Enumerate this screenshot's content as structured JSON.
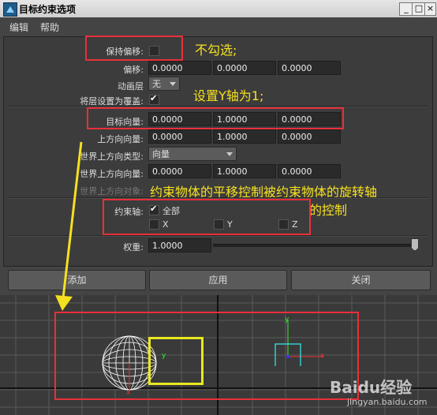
{
  "window": {
    "title": "目标约束选项"
  },
  "menu": {
    "items": [
      "编辑",
      "帮助"
    ]
  },
  "options": {
    "maintain_offset_label": "保持偏移:",
    "maintain_offset_checked": false,
    "offset_label": "偏移:",
    "offset_values": [
      "0.0000",
      "0.0000",
      "0.0000"
    ],
    "anim_layer_label": "动画层",
    "anim_layer_value": "无",
    "set_layer_override_label": "将层设置为覆盖:",
    "set_layer_override_checked": true,
    "aim_vector_label": "目标向量:",
    "aim_vector_values": [
      "0.0000",
      "1.0000",
      "0.0000"
    ],
    "up_vector_label": "上方向向量:",
    "up_vector_values": [
      "0.0000",
      "1.0000",
      "0.0000"
    ],
    "world_up_type_label": "世界上方向类型:",
    "world_up_type_value": "向量",
    "world_up_vector_label": "世界上方向向量:",
    "world_up_vector_values": [
      "0.0000",
      "1.0000",
      "0.0000"
    ],
    "world_up_object_label": "世界上方向对象:",
    "constraint_axes_label": "约束轴:",
    "axis_all_label": "全部",
    "axis_all_checked": true,
    "axis_x_label": "X",
    "axis_y_label": "Y",
    "axis_z_label": "Z",
    "weight_label": "权重:",
    "weight_value": "1.0000",
    "weight_slider_fraction": 1.0
  },
  "buttons": {
    "add": "添加",
    "apply": "应用",
    "close": "关闭"
  },
  "annotations": {
    "uncheck": "不勾选;",
    "set_y_axis": "设置Y轴为1;",
    "explain_line1": "约束物体的平移控制被约束物体的旋转轴",
    "explain_line2": "的控制"
  },
  "viewport": {
    "axis_labels": {
      "x": "x",
      "y": "y",
      "z": "z"
    }
  },
  "watermark": {
    "brand": "Baidu经验",
    "url": "jingyan.baidu.com"
  },
  "colors": {
    "annotation": "#f5e020",
    "highlight_box": "#e8303a",
    "object_box": "#e8e820"
  }
}
